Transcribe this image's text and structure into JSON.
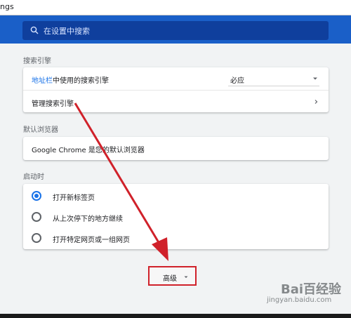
{
  "browser": {
    "url_fragment": "ngs"
  },
  "header": {
    "search_placeholder": "在设置中搜索"
  },
  "search_engine": {
    "section_title": "搜索引擎",
    "address_bar_link": "地址栏",
    "address_bar_label_rest": "中使用的搜索引擎",
    "selected_engine": "必应",
    "manage_label": "管理搜索引擎"
  },
  "default_browser": {
    "section_title": "默认浏览器",
    "status": "Google Chrome 是您的默认浏览器"
  },
  "startup": {
    "section_title": "启动时",
    "options": [
      {
        "label": "打开新标签页",
        "selected": true
      },
      {
        "label": "从上次停下的地方继续",
        "selected": false
      },
      {
        "label": "打开特定网页或一组网页",
        "selected": false
      }
    ]
  },
  "advanced": {
    "label": "高级"
  },
  "watermark": {
    "brand": "Bai百经验",
    "sub": "jingyan.baidu.com"
  },
  "colors": {
    "header_blue": "#1a5fc8",
    "search_box": "#0f3f9d",
    "link_blue": "#1a73e8",
    "annotation_red": "#d0212a",
    "page_bg": "#f1f3f4"
  }
}
